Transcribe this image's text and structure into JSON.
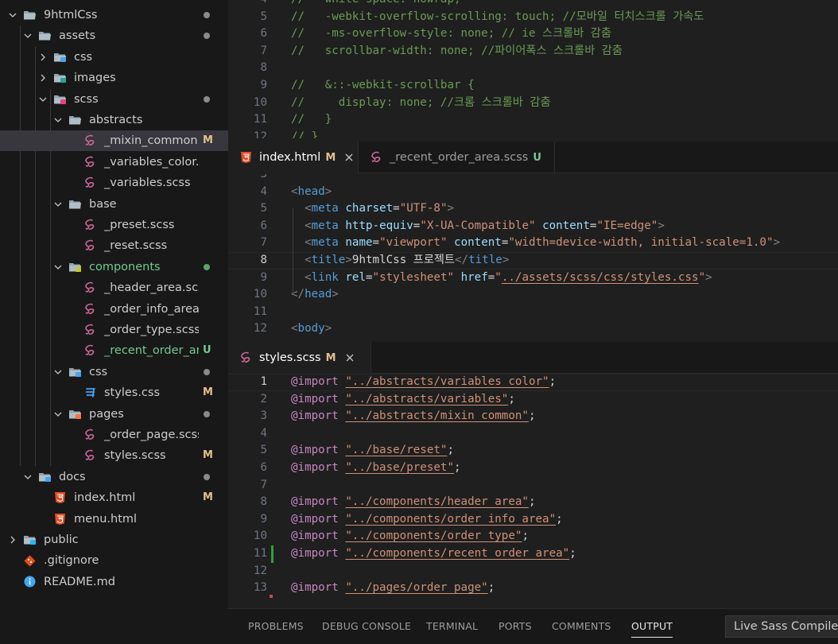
{
  "explorer": {
    "items": [
      {
        "name": "9htmlCss",
        "badge": "",
        "dot": "gray",
        "color": "#cccccc",
        "icon": "folder-open-icon",
        "chevron": "down"
      },
      {
        "name": "assets",
        "badge": "",
        "dot": "gray",
        "color": "#cccccc",
        "icon": "folder-open-icon",
        "chevron": "down"
      },
      {
        "name": "css",
        "badge": "",
        "dot": "",
        "color": "#cccccc",
        "icon": "folder-css-icon",
        "chevron": "right"
      },
      {
        "name": "images",
        "badge": "",
        "dot": "",
        "color": "#cccccc",
        "icon": "folder-images-icon",
        "chevron": "right"
      },
      {
        "name": "scss",
        "badge": "",
        "dot": "gray",
        "color": "#cccccc",
        "icon": "folder-scss-open-icon",
        "chevron": "down"
      },
      {
        "name": "abstracts",
        "badge": "",
        "dot": "",
        "color": "#cccccc",
        "icon": "folder-open-icon",
        "chevron": "down"
      },
      {
        "name": "_mixin_common.scss",
        "badge": "M",
        "dot": "",
        "color": "#cccccc",
        "icon": "sass-icon",
        "chevron": ""
      },
      {
        "name": "_variables_color.scss",
        "badge": "",
        "dot": "",
        "color": "#cccccc",
        "icon": "sass-icon",
        "chevron": ""
      },
      {
        "name": "_variables.scss",
        "badge": "",
        "dot": "",
        "color": "#cccccc",
        "icon": "sass-icon",
        "chevron": ""
      },
      {
        "name": "base",
        "badge": "",
        "dot": "",
        "color": "#cccccc",
        "icon": "folder-open-icon",
        "chevron": "down"
      },
      {
        "name": "_preset.scss",
        "badge": "",
        "dot": "",
        "color": "#cccccc",
        "icon": "sass-icon",
        "chevron": ""
      },
      {
        "name": "_reset.scss",
        "badge": "",
        "dot": "",
        "color": "#cccccc",
        "icon": "sass-icon",
        "chevron": ""
      },
      {
        "name": "components",
        "badge": "",
        "dot": "green",
        "color": "#73c991",
        "icon": "folder-components-open-icon",
        "chevron": "down"
      },
      {
        "name": "_header_area.scss",
        "badge": "",
        "dot": "",
        "color": "#cccccc",
        "icon": "sass-icon",
        "chevron": ""
      },
      {
        "name": "_order_info_area.scss",
        "badge": "",
        "dot": "",
        "color": "#cccccc",
        "icon": "sass-icon",
        "chevron": ""
      },
      {
        "name": "_order_type.scss",
        "badge": "",
        "dot": "",
        "color": "#cccccc",
        "icon": "sass-icon",
        "chevron": ""
      },
      {
        "name": "_recent_order_area.sc...",
        "badge": "U",
        "dot": "",
        "color": "#73c991",
        "icon": "sass-icon",
        "chevron": ""
      },
      {
        "name": "css",
        "badge": "",
        "dot": "gray",
        "color": "#cccccc",
        "icon": "folder-css-open-icon",
        "chevron": "down"
      },
      {
        "name": "styles.css",
        "badge": "M",
        "dot": "",
        "color": "#cccccc",
        "icon": "css-file-icon",
        "chevron": ""
      },
      {
        "name": "pages",
        "badge": "",
        "dot": "gray",
        "color": "#cccccc",
        "icon": "folder-pages-open-icon",
        "chevron": "down"
      },
      {
        "name": "_order_page.scss",
        "badge": "",
        "dot": "",
        "color": "#cccccc",
        "icon": "sass-icon",
        "chevron": ""
      },
      {
        "name": "styles.scss",
        "badge": "M",
        "dot": "",
        "color": "#cccccc",
        "icon": "sass-icon",
        "chevron": ""
      },
      {
        "name": "docs",
        "badge": "",
        "dot": "gray",
        "color": "#cccccc",
        "icon": "folder-docs-open-icon",
        "chevron": "down"
      },
      {
        "name": "index.html",
        "badge": "M",
        "dot": "",
        "color": "#cccccc",
        "icon": "html-file-icon",
        "chevron": ""
      },
      {
        "name": "menu.html",
        "badge": "",
        "dot": "",
        "color": "#cccccc",
        "icon": "html-file-icon",
        "chevron": ""
      },
      {
        "name": "public",
        "badge": "",
        "dot": "",
        "color": "#cccccc",
        "icon": "folder-public-icon",
        "chevron": "right"
      },
      {
        "name": ".gitignore",
        "badge": "",
        "dot": "",
        "color": "#cccccc",
        "icon": "git-icon",
        "chevron": ""
      },
      {
        "name": "README.md",
        "badge": "",
        "dot": "",
        "color": "#cccccc",
        "icon": "info-icon",
        "chevron": ""
      }
    ]
  },
  "top_editor": {
    "lines": [
      {
        "n": "4",
        "text": "//   white-space: nowrap;"
      },
      {
        "n": "5",
        "text": "//   -webkit-overflow-scrolling: touch; //모바일 터치스크롤 가속도"
      },
      {
        "n": "6",
        "text": "//   -ms-overflow-style: none; // ie 스크롤바 감춤"
      },
      {
        "n": "7",
        "text": "//   scrollbar-width: none; //파이어폭스 스크롤바 감춤"
      },
      {
        "n": "8",
        "text": ""
      },
      {
        "n": "9",
        "text": "//   &::-webkit-scrollbar {"
      },
      {
        "n": "10",
        "text": "//     display: none; //크롬 스크롤바 감춤"
      },
      {
        "n": "11",
        "text": "//   }"
      },
      {
        "n": "12",
        "text": "// }"
      }
    ]
  },
  "html_group": {
    "tabs": [
      {
        "label": "index.html",
        "marker": "M",
        "marker_color": "#e2c08d",
        "icon": "html-file-icon",
        "close": true
      },
      {
        "label": "_recent_order_area.scss",
        "marker": "U",
        "marker_color": "#73c991",
        "icon": "sass-icon",
        "close": false
      }
    ],
    "lines": [
      {
        "n": "3",
        "tokens": []
      },
      {
        "n": "4",
        "tokens": [
          {
            "t": "<",
            "c": "br"
          },
          {
            "t": "head",
            "c": "tag"
          },
          {
            "t": ">",
            "c": "br"
          }
        ]
      },
      {
        "n": "5",
        "tokens": [
          {
            "t": "  ",
            "c": "txt"
          },
          {
            "t": "<",
            "c": "br"
          },
          {
            "t": "meta",
            "c": "tag"
          },
          {
            "t": " ",
            "c": "txt"
          },
          {
            "t": "charset",
            "c": "attr"
          },
          {
            "t": "=",
            "c": "txt"
          },
          {
            "t": "\"UTF-8\"",
            "c": "str"
          },
          {
            "t": ">",
            "c": "br"
          }
        ]
      },
      {
        "n": "6",
        "tokens": [
          {
            "t": "  ",
            "c": "txt"
          },
          {
            "t": "<",
            "c": "br"
          },
          {
            "t": "meta",
            "c": "tag"
          },
          {
            "t": " ",
            "c": "txt"
          },
          {
            "t": "http-equiv",
            "c": "attr"
          },
          {
            "t": "=",
            "c": "txt"
          },
          {
            "t": "\"X-UA-Compatible\"",
            "c": "str"
          },
          {
            "t": " ",
            "c": "txt"
          },
          {
            "t": "content",
            "c": "attr"
          },
          {
            "t": "=",
            "c": "txt"
          },
          {
            "t": "\"IE=edge\"",
            "c": "str"
          },
          {
            "t": ">",
            "c": "br"
          }
        ]
      },
      {
        "n": "7",
        "tokens": [
          {
            "t": "  ",
            "c": "txt"
          },
          {
            "t": "<",
            "c": "br"
          },
          {
            "t": "meta",
            "c": "tag"
          },
          {
            "t": " ",
            "c": "txt"
          },
          {
            "t": "name",
            "c": "attr"
          },
          {
            "t": "=",
            "c": "txt"
          },
          {
            "t": "\"viewport\"",
            "c": "str"
          },
          {
            "t": " ",
            "c": "txt"
          },
          {
            "t": "content",
            "c": "attr"
          },
          {
            "t": "=",
            "c": "txt"
          },
          {
            "t": "\"width=device-width, initial-scale=1.0\"",
            "c": "str"
          },
          {
            "t": ">",
            "c": "br"
          }
        ]
      },
      {
        "n": "8",
        "tokens": [
          {
            "t": "  ",
            "c": "txt"
          },
          {
            "t": "<",
            "c": "br"
          },
          {
            "t": "title",
            "c": "tag"
          },
          {
            "t": ">",
            "c": "br"
          },
          {
            "t": "9htmlCss 프로젝트",
            "c": "txt"
          },
          {
            "t": "</",
            "c": "br"
          },
          {
            "t": "title",
            "c": "tag"
          },
          {
            "t": ">",
            "c": "br"
          }
        ]
      },
      {
        "n": "9",
        "tokens": [
          {
            "t": "  ",
            "c": "txt"
          },
          {
            "t": "<",
            "c": "br"
          },
          {
            "t": "link",
            "c": "tag"
          },
          {
            "t": " ",
            "c": "txt"
          },
          {
            "t": "rel",
            "c": "attr"
          },
          {
            "t": "=",
            "c": "txt"
          },
          {
            "t": "\"stylesheet\"",
            "c": "str"
          },
          {
            "t": " ",
            "c": "txt"
          },
          {
            "t": "href",
            "c": "attr"
          },
          {
            "t": "=",
            "c": "txt"
          },
          {
            "t": "\"",
            "c": "str"
          },
          {
            "t": "../assets/scss/css/styles.css",
            "c": "path"
          },
          {
            "t": "\"",
            "c": "str"
          },
          {
            "t": ">",
            "c": "br"
          }
        ]
      },
      {
        "n": "10",
        "tokens": [
          {
            "t": "</",
            "c": "br"
          },
          {
            "t": "head",
            "c": "tag"
          },
          {
            "t": ">",
            "c": "br"
          }
        ]
      },
      {
        "n": "11",
        "tokens": []
      },
      {
        "n": "12",
        "tokens": [
          {
            "t": "<",
            "c": "br"
          },
          {
            "t": "body",
            "c": "tag"
          },
          {
            "t": ">",
            "c": "br"
          }
        ]
      }
    ]
  },
  "scss_group": {
    "tabs": [
      {
        "label": "styles.scss",
        "marker": "M",
        "marker_color": "#e2c08d",
        "icon": "sass-icon",
        "close": true
      }
    ],
    "lines": [
      {
        "n": "1",
        "tokens": [
          {
            "t": "@import",
            "c": "at"
          },
          {
            "t": " ",
            "c": "txt"
          },
          {
            "t": "\"../abstracts/variables_color\"",
            "c": "path"
          },
          {
            "t": ";",
            "c": "txt"
          }
        ]
      },
      {
        "n": "2",
        "tokens": [
          {
            "t": "@import",
            "c": "at"
          },
          {
            "t": " ",
            "c": "txt"
          },
          {
            "t": "\"../abstracts/variables\"",
            "c": "path"
          },
          {
            "t": ";",
            "c": "txt"
          }
        ]
      },
      {
        "n": "3",
        "tokens": [
          {
            "t": "@import",
            "c": "at"
          },
          {
            "t": " ",
            "c": "txt"
          },
          {
            "t": "\"../abstracts/mixin_common\"",
            "c": "path"
          },
          {
            "t": ";",
            "c": "txt"
          }
        ]
      },
      {
        "n": "4",
        "tokens": []
      },
      {
        "n": "5",
        "tokens": [
          {
            "t": "@import",
            "c": "at"
          },
          {
            "t": " ",
            "c": "txt"
          },
          {
            "t": "\"../base/reset\"",
            "c": "path"
          },
          {
            "t": ";",
            "c": "txt"
          }
        ]
      },
      {
        "n": "6",
        "tokens": [
          {
            "t": "@import",
            "c": "at"
          },
          {
            "t": " ",
            "c": "txt"
          },
          {
            "t": "\"../base/preset\"",
            "c": "path"
          },
          {
            "t": ";",
            "c": "txt"
          }
        ]
      },
      {
        "n": "7",
        "tokens": []
      },
      {
        "n": "8",
        "tokens": [
          {
            "t": "@import",
            "c": "at"
          },
          {
            "t": " ",
            "c": "txt"
          },
          {
            "t": "\"../components/header_area\"",
            "c": "path"
          },
          {
            "t": ";",
            "c": "txt"
          }
        ]
      },
      {
        "n": "9",
        "tokens": [
          {
            "t": "@import",
            "c": "at"
          },
          {
            "t": " ",
            "c": "txt"
          },
          {
            "t": "\"../components/order_info_area\"",
            "c": "path"
          },
          {
            "t": ";",
            "c": "txt"
          }
        ]
      },
      {
        "n": "10",
        "tokens": [
          {
            "t": "@import",
            "c": "at"
          },
          {
            "t": " ",
            "c": "txt"
          },
          {
            "t": "\"../components/order_type\"",
            "c": "path"
          },
          {
            "t": ";",
            "c": "txt"
          }
        ]
      },
      {
        "n": "11",
        "tokens": [
          {
            "t": "@import",
            "c": "at"
          },
          {
            "t": " ",
            "c": "txt"
          },
          {
            "t": "\"../components/recent_order_area\"",
            "c": "path"
          },
          {
            "t": ";",
            "c": "txt"
          }
        ]
      },
      {
        "n": "12",
        "tokens": []
      },
      {
        "n": "13",
        "tokens": [
          {
            "t": "@import",
            "c": "at"
          },
          {
            "t": " ",
            "c": "txt"
          },
          {
            "t": "\"../pages/order_page\"",
            "c": "path"
          },
          {
            "t": ";",
            "c": "txt"
          }
        ]
      }
    ]
  },
  "panel": {
    "tabs": [
      "PROBLEMS",
      "DEBUG CONSOLE",
      "TERMINAL",
      "PORTS",
      "COMMENTS",
      "OUTPUT"
    ],
    "active": "OUTPUT",
    "status_button": "Live Sass Compile"
  },
  "colors": {
    "sass": "#cd6799",
    "html": "#e44d26",
    "css": "#42a5f5",
    "modified": "#e2c08d",
    "untracked": "#73c991",
    "git_added": "#2ea043"
  }
}
